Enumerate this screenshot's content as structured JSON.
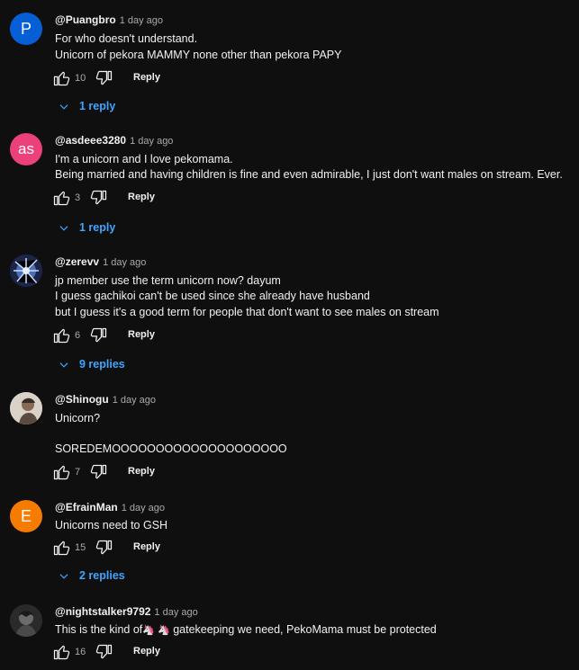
{
  "comments": [
    {
      "author": "@Puangbro",
      "time": "1 day ago",
      "avatar_letter": "P",
      "avatar_color": "#065fd4",
      "lines": [
        "For who doesn't understand.",
        "Unicorn of pekora MAMMY none other than pekora PAPY"
      ],
      "likes": "10",
      "reply_label": "Reply",
      "replies_label": "1 reply"
    },
    {
      "author": "@asdeee3280",
      "time": "1 day ago",
      "avatar_letter": "as",
      "avatar_color": "#ec407a",
      "lines": [
        "I'm a unicorn and I love pekomama.",
        "Being married and having children is fine and even admirable, I just don't want males on stream. Ever."
      ],
      "likes": "3",
      "reply_label": "Reply",
      "replies_label": "1 reply"
    },
    {
      "author": "@zerevv",
      "time": "1 day ago",
      "avatar_letter": "",
      "avatar_color": "#2b3a6b",
      "lines": [
        "jp member use the term unicorn now? dayum",
        "I guess gachikoi can't be used since she already have husband",
        "but I guess it's a good term for people that don't want to see males on stream"
      ],
      "likes": "6",
      "reply_label": "Reply",
      "replies_label": "9 replies"
    },
    {
      "author": "@Shinogu",
      "time": "1 day ago",
      "avatar_letter": "",
      "avatar_color": "#c9c2b8",
      "lines": [
        "Unicorn?",
        "",
        "SOREDEMOOOOOOOOOOOOOOOOOOOO"
      ],
      "likes": "7",
      "reply_label": "Reply",
      "replies_label": ""
    },
    {
      "author": "@EfrainMan",
      "time": "1 day ago",
      "avatar_letter": "E",
      "avatar_color": "#f57c00",
      "lines": [
        "Unicorns need to GSH"
      ],
      "likes": "15",
      "reply_label": "Reply",
      "replies_label": "2 replies"
    },
    {
      "author": "@nightstalker9792",
      "time": "1 day ago",
      "avatar_letter": "",
      "avatar_color": "#3a3a3a",
      "lines": [
        "This is the kind of",
        "gatekeeping we need, PekoMama must be protected"
      ],
      "emoji": "🦄 🦄",
      "likes": "16",
      "reply_label": "Reply",
      "replies_label": ""
    }
  ]
}
